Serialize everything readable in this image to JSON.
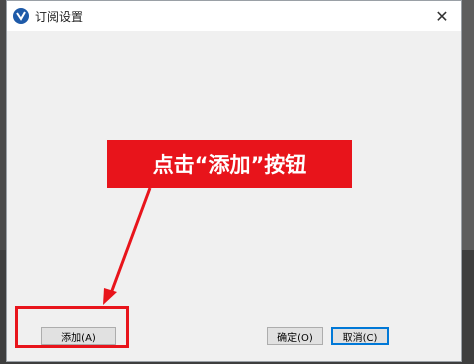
{
  "window": {
    "title": "订阅设置",
    "close_glyph": "✕",
    "icon": "app-logo-icon"
  },
  "buttons": {
    "add_label": "添加(A)",
    "ok_label": "确定(O)",
    "cancel_label": "取消(C)"
  },
  "annotation": {
    "callout_text": "点击“添加”按钮",
    "color": "#e8141b"
  }
}
